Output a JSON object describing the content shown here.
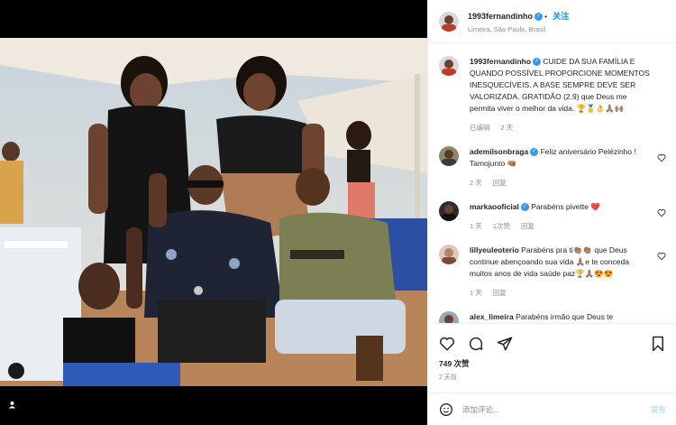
{
  "post": {
    "username": "1993fernandinho",
    "verified": true,
    "follow_label": "关注",
    "location": "Limeira, São Paulo, Brasil"
  },
  "caption": {
    "username": "1993fernandinho",
    "text": "CUIDE DA SUA FAMÍLIA E QUANDO POSSÍVEL PROPORCIONE MOMENTOS INESQUECÍVEIS. A BASE SEMPRE DEVE SER VALORIZADA. GRATIDÃO (2.9) que Deus me permita viver o melhor da vida. 🏆🥇👌🙏🏽🙌🏽",
    "edited": "已编辑",
    "age": "2 天"
  },
  "comments": [
    {
      "username": "ademilsonbraga",
      "verified": true,
      "text": "Feliz aniversário Pelézinho ! Tamojunto 🤜🏽",
      "age": "2 天",
      "reply": "回复",
      "likes": ""
    },
    {
      "username": "markaooficial",
      "verified": true,
      "text": "Parabéns pivette ❤️",
      "age": "1 天",
      "likes": "1次赞",
      "reply": "回复"
    },
    {
      "username": "lillyeuleoterio",
      "verified": false,
      "text": "Parabéns pra ti👏🏽👏🏽 que Deus continue abençoando sua vida 🙏🏽e te conceda muitos anos de vida saúde paz🏆🙏🏽😍😍",
      "age": "1 天",
      "reply": "回复",
      "likes": ""
    },
    {
      "username": "alex_limeira",
      "verified": false,
      "text": "Parabéns irmão que Deus te",
      "age": "",
      "reply": "",
      "likes": ""
    }
  ],
  "actions": {
    "likes": "749 次赞",
    "age": "2 天前"
  },
  "composer": {
    "placeholder": "添加评论...",
    "post_label": "发布"
  },
  "icons": {
    "like": "heart-icon",
    "comment": "comment-icon",
    "share": "share-icon",
    "save": "bookmark-icon",
    "emoji": "emoji-icon",
    "tag": "user-tag-icon"
  },
  "colors": {
    "accent": "#0095f6",
    "verified": "#3897f0",
    "muted": "#8e8e8e"
  }
}
